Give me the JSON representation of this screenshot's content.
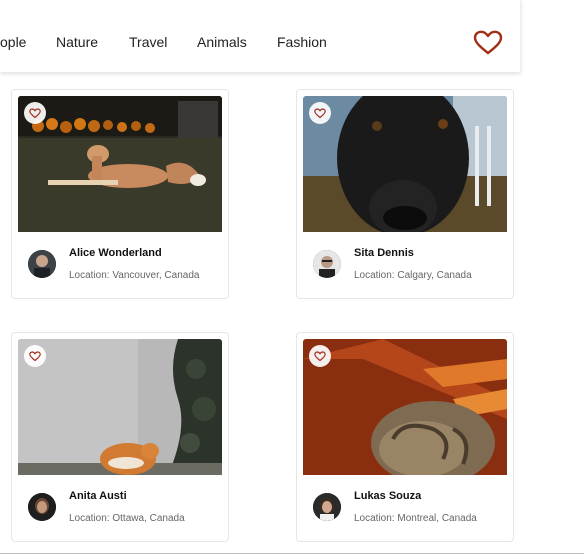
{
  "nav": {
    "items": [
      "ople",
      "Nature",
      "Travel",
      "Animals",
      "Fashion"
    ],
    "favorites_icon": "heart-outline-icon"
  },
  "colors": {
    "heart": "#a0301a",
    "text": "#222222",
    "muted": "#666666"
  },
  "cards": [
    {
      "name": "Alice Wonderland",
      "location": "Location: Vancouver, Canada",
      "photo": "dog-lying-on-grass",
      "like_icon": "heart-icon"
    },
    {
      "name": "Sita Dennis",
      "location": "Location: Calgary, Canada",
      "photo": "black-dog-closeup",
      "like_icon": "heart-icon"
    },
    {
      "name": "Anita Austi",
      "location": "Location: Ottawa, Canada",
      "photo": "orange-cat-by-wall",
      "like_icon": "heart-icon"
    },
    {
      "name": "Lukas Souza",
      "location": "Location: Montreal, Canada",
      "photo": "tabby-cat-sleeping",
      "like_icon": "heart-icon"
    }
  ]
}
